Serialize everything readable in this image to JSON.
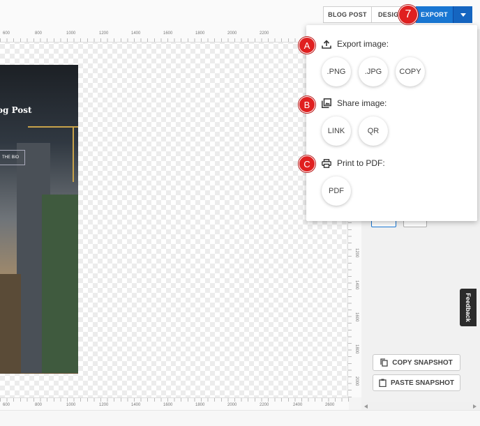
{
  "toolbar": {
    "tab_blog_post": "BLOG POST",
    "tab_design": "DESIGN",
    "export_label": "EXPORT",
    "export_dropdown_icon": "caret-down-icon"
  },
  "canvas": {
    "ruler_top_ticks": [
      "600",
      "800",
      "1000",
      "1200",
      "1400",
      "1600",
      "1800",
      "2000",
      "2200"
    ],
    "ruler_bottom_ticks": [
      "600",
      "800",
      "1000",
      "1200",
      "1400",
      "1600",
      "1800",
      "2000",
      "2200",
      "2400",
      "2600"
    ],
    "ruler_right_ticks": [
      "1200",
      "1400",
      "1600",
      "1800",
      "2000"
    ],
    "post_title": "og Post",
    "post_button": "THE BIO"
  },
  "annotations": {
    "step": "7",
    "a": "A",
    "b": "B",
    "c": "C"
  },
  "export_menu": {
    "export_image": {
      "title": "Export image:",
      "icon": "upload-icon",
      "options": [
        ".PNG",
        ".JPG",
        "COPY"
      ]
    },
    "share_image": {
      "title": "Share image:",
      "icon": "image-icon",
      "options": [
        "LINK",
        "QR"
      ]
    },
    "print_pdf": {
      "title": "Print to PDF:",
      "icon": "printer-icon",
      "options": [
        "PDF"
      ]
    }
  },
  "side_panel": {
    "copy_snapshot": "COPY SNAPSHOT",
    "paste_snapshot": "PASTE SNAPSHOT",
    "feedback": "Feedback"
  },
  "colors": {
    "export_button": "#1976d2",
    "badge": "#e02020"
  }
}
